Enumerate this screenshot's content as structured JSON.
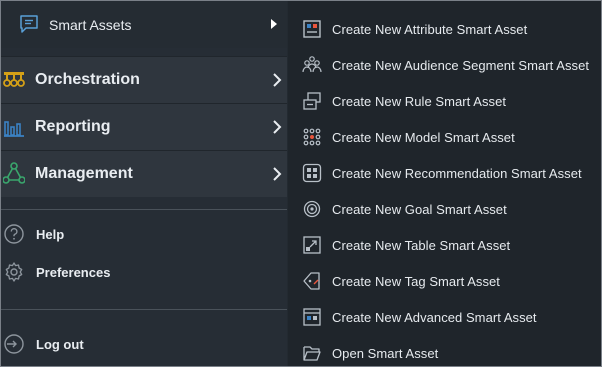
{
  "sidebar": {
    "top_item": {
      "label": "Smart Assets",
      "icon": "chat-list-icon"
    },
    "nav_items": [
      {
        "label": "Orchestration",
        "icon": "orchestration-icon",
        "icon_color": "#d4a017"
      },
      {
        "label": "Reporting",
        "icon": "bar-chart-icon",
        "icon_color": "#3b82c4"
      },
      {
        "label": "Management",
        "icon": "network-icon",
        "icon_color": "#3aa76d"
      }
    ],
    "utility_items": [
      {
        "label": "Help",
        "icon": "question-circle-icon"
      },
      {
        "label": "Preferences",
        "icon": "gear-icon"
      }
    ],
    "logout": {
      "label": "Log out",
      "icon": "logout-icon"
    }
  },
  "submenu": {
    "items": [
      {
        "label": "Create New Attribute Smart Asset",
        "icon": "attribute-icon"
      },
      {
        "label": "Create New Audience Segment Smart Asset",
        "icon": "audience-icon"
      },
      {
        "label": "Create New Rule Smart Asset",
        "icon": "rule-icon"
      },
      {
        "label": "Create New Model Smart Asset",
        "icon": "model-icon"
      },
      {
        "label": "Create New Recommendation Smart Asset",
        "icon": "recommendation-icon"
      },
      {
        "label": "Create New Goal Smart Asset",
        "icon": "goal-icon"
      },
      {
        "label": "Create New Table Smart Asset",
        "icon": "table-icon"
      },
      {
        "label": "Create New Tag Smart Asset",
        "icon": "tag-icon"
      },
      {
        "label": "Create New Advanced Smart Asset",
        "icon": "advanced-icon"
      },
      {
        "label": "Open Smart Asset",
        "icon": "folder-open-icon"
      }
    ]
  },
  "colors": {
    "accent_blue": "#3b82c4",
    "accent_orange": "#e8553d",
    "icon_gray": "#b8c0c8"
  }
}
